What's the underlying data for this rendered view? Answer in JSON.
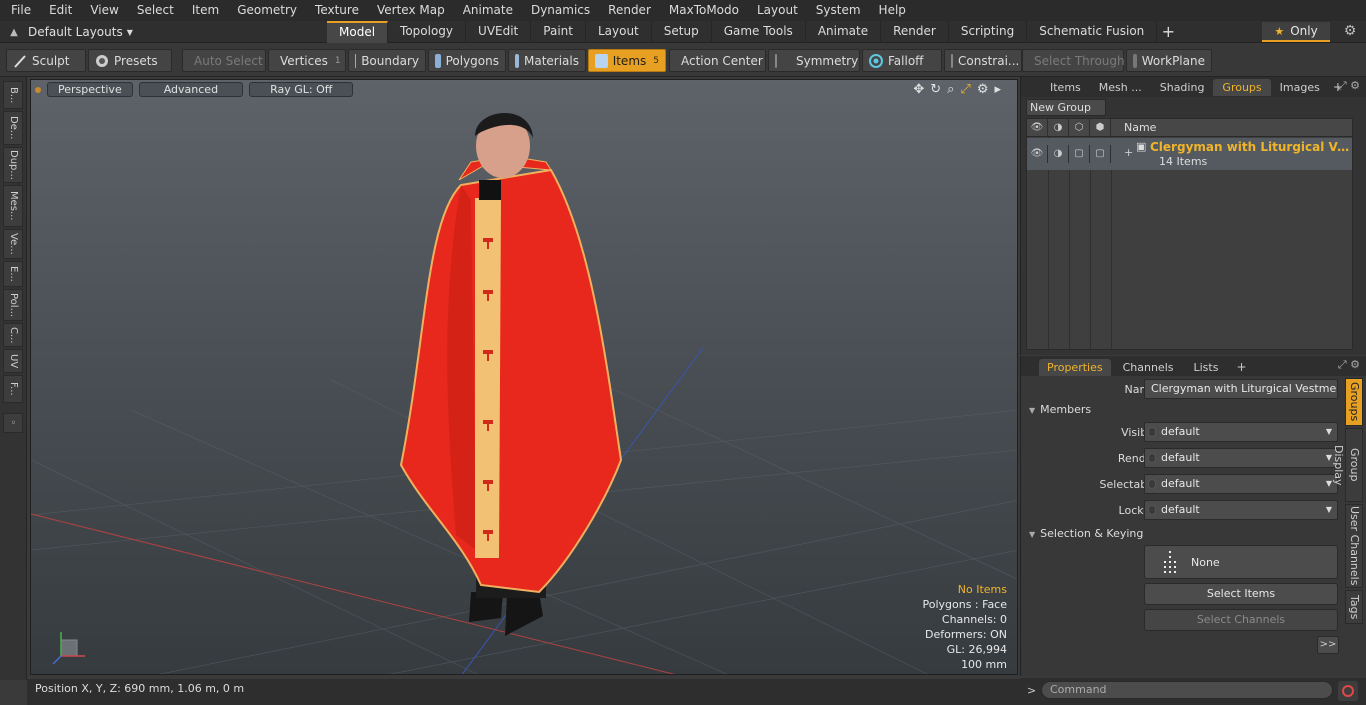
{
  "menu": [
    "File",
    "Edit",
    "View",
    "Select",
    "Item",
    "Geometry",
    "Texture",
    "Vertex Map",
    "Animate",
    "Dynamics",
    "Render",
    "MaxToModo",
    "Layout",
    "System",
    "Help"
  ],
  "layouts": {
    "label": "Default Layouts"
  },
  "tabs": [
    "Model",
    "Topology",
    "UVEdit",
    "Paint",
    "Layout",
    "Setup",
    "Game Tools",
    "Animate",
    "Render",
    "Scripting",
    "Schematic Fusion"
  ],
  "only_label": "Only",
  "toolbar": {
    "sculpt": "Sculpt",
    "presets": "Presets",
    "auto_select": "Auto Select",
    "vertices": "Vertices",
    "vertices_count": "1",
    "boundary": "Boundary",
    "polygons": "Polygons",
    "materials": "Materials",
    "items": "Items",
    "items_count": "5",
    "action_center": "Action Center",
    "symmetry": "Symmetry",
    "falloff": "Falloff",
    "constraints": "Constrai...",
    "select_through": "Select Through",
    "workplane": "WorkPlane"
  },
  "left_tabs": [
    "B...",
    "De...",
    "Dup...",
    "Mes...",
    "Ve...",
    "E...",
    "Pol...",
    "C...",
    "UV",
    "F..."
  ],
  "viewport": {
    "perspective": "Perspective",
    "advanced": "Advanced",
    "raygl": "Ray GL: Off",
    "stats": {
      "selection": "No Items",
      "polygons": "Polygons : Face",
      "channels": "Channels: 0",
      "deformers": "Deformers: ON",
      "gl": "GL: 26,994",
      "scale": "100 mm"
    }
  },
  "status": {
    "position": "Position X, Y, Z:  690 mm, 1.06 m, 0 m"
  },
  "top_panel": {
    "tabs": [
      "Items",
      "Mesh ...",
      "Shading",
      "Groups",
      "Images"
    ],
    "active_tab": "Groups",
    "new_group": "New Group",
    "col_name": "Name",
    "group": {
      "name": "Clergyman with Liturgical Vestm...",
      "count": "14 Items"
    }
  },
  "props": {
    "tabs": [
      "Properties",
      "Channels",
      "Lists"
    ],
    "name_label": "Name",
    "name_value": "Clergyman with Liturgical Vestment Re",
    "members": "Members",
    "visible_label": "Visible",
    "visible": "default",
    "render_label": "Render",
    "render": "default",
    "selectable_label": "Selectable",
    "selectable": "default",
    "locked_label": "Locked",
    "locked": "default",
    "sel_keying": "Selection & Keying",
    "none": "None",
    "select_items": "Select Items",
    "select_channels": "Select Channels",
    "more": ">>",
    "vtabs": [
      "Groups",
      "Group Display",
      "User Channels",
      "Tags"
    ]
  },
  "command": {
    "placeholder": "Command",
    "prompt": ">"
  },
  "colors": {
    "accent": "#e8a022",
    "vestment_red": "#e8281c",
    "stole_gold": "#f3c173"
  }
}
